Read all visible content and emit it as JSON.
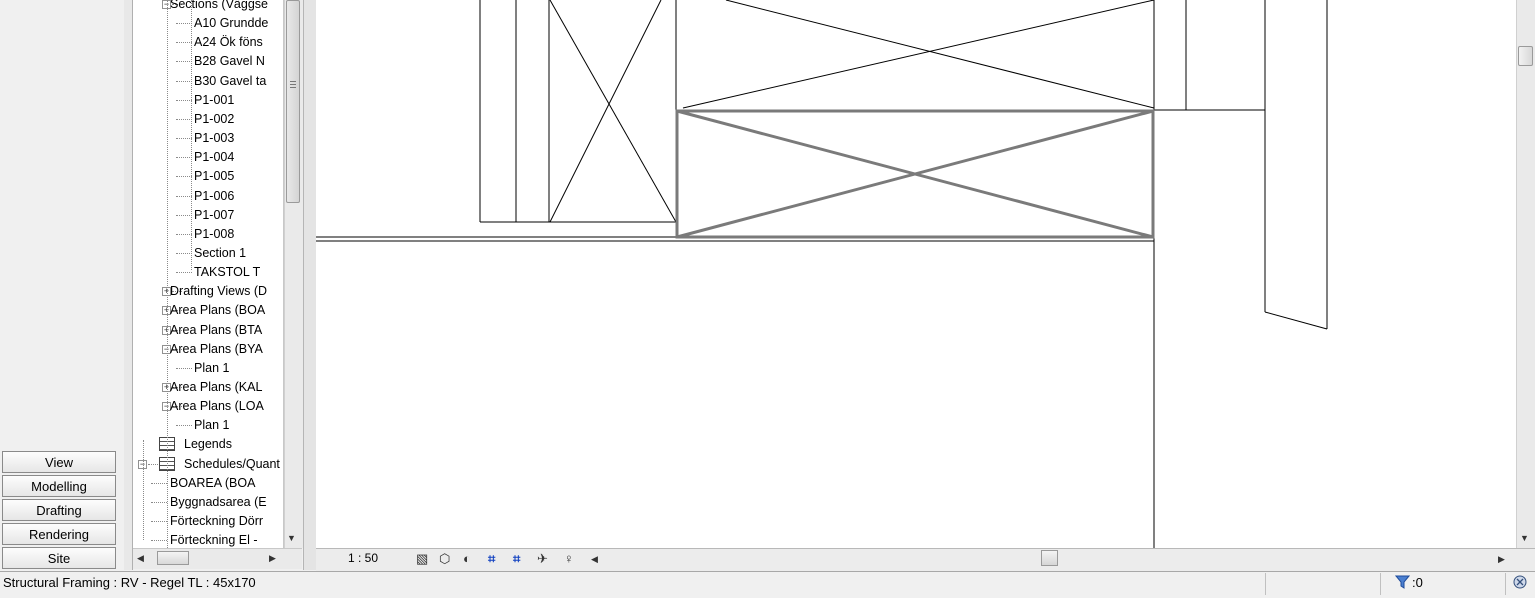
{
  "design_bar": {
    "tabs": [
      "View",
      "Modelling",
      "Drafting",
      "Rendering",
      "Site"
    ]
  },
  "project_browser": {
    "items": [
      {
        "label": "Sections (Väggse",
        "level": 2,
        "expander": "minus"
      },
      {
        "label": "A10 Grundde",
        "level": 3
      },
      {
        "label": "A24 Ök föns",
        "level": 3
      },
      {
        "label": "B28 Gavel N",
        "level": 3
      },
      {
        "label": "B30 Gavel ta",
        "level": 3
      },
      {
        "label": "P1-001",
        "level": 3
      },
      {
        "label": "P1-002",
        "level": 3
      },
      {
        "label": "P1-003",
        "level": 3
      },
      {
        "label": "P1-004",
        "level": 3
      },
      {
        "label": "P1-005",
        "level": 3
      },
      {
        "label": "P1-006",
        "level": 3
      },
      {
        "label": "P1-007",
        "level": 3
      },
      {
        "label": "P1-008",
        "level": 3
      },
      {
        "label": "Section 1",
        "level": 3
      },
      {
        "label": "TAKSTOL T",
        "level": 3
      },
      {
        "label": "Drafting Views (D",
        "level": 2,
        "expander": "plus"
      },
      {
        "label": "Area Plans (BOA",
        "level": 2,
        "expander": "plus"
      },
      {
        "label": "Area Plans (BTA",
        "level": 2,
        "expander": "plus"
      },
      {
        "label": "Area Plans (BYA",
        "level": 2,
        "expander": "minus"
      },
      {
        "label": "Plan 1",
        "level": 3
      },
      {
        "label": "Area Plans (KAL",
        "level": 2,
        "expander": "plus"
      },
      {
        "label": "Area Plans (LOA",
        "level": 2,
        "expander": "minus"
      },
      {
        "label": "Plan 1",
        "level": 3
      },
      {
        "label": "Legends",
        "level": 1,
        "icon": "legend-icon"
      },
      {
        "label": "Schedules/Quant",
        "level": 1,
        "expander": "minus",
        "icon": "schedule-icon"
      },
      {
        "label": "BOAREA (BOA",
        "level": 2
      },
      {
        "label": "Byggnadsarea (E",
        "level": 2
      },
      {
        "label": "Förteckning Dörr",
        "level": 2
      },
      {
        "label": "Förteckning El -",
        "level": 2
      }
    ]
  },
  "view_control_bar": {
    "scale": "1 : 50"
  },
  "status_bar": {
    "text": "Structural Framing : RV - Regel TL : 45x170",
    "filter_count": ":0"
  }
}
